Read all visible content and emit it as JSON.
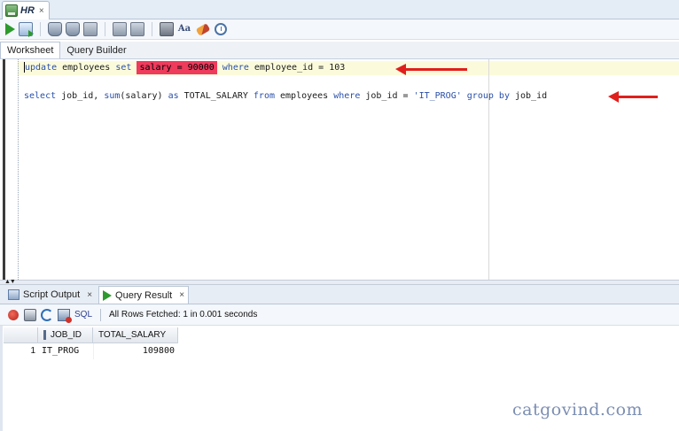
{
  "doc_tab": {
    "label": "HR",
    "close": "×"
  },
  "toolbar": {
    "icons": [
      "run-statement-icon",
      "run-script-icon",
      "commit-icon",
      "rollback-icon",
      "sql-tuning-icon",
      "explain-plan-icon",
      "autotrace-icon",
      "sql-history-icon",
      "format-icon",
      "clear-icon",
      "timer-icon"
    ],
    "format_glyph": "Aa"
  },
  "sub_tabs": [
    "Worksheet",
    "Query Builder"
  ],
  "editor": {
    "line1": {
      "kw_update": "update",
      "t_employees": " employees ",
      "kw_set": "set",
      "highlight": "salary = 90000",
      "kw_where": "where",
      "tail": " employee_id = 103"
    },
    "line2": {
      "kw_select": "select",
      "t1": " job_id, ",
      "kw_sum": "sum",
      "t2": "(salary) ",
      "kw_as": "as",
      "t3": " TOTAL_SALARY ",
      "kw_from": "from",
      "t4": " employees ",
      "kw_where": "where",
      "t5": " job_id = ",
      "str": "'IT_PROG'",
      "sp": " ",
      "kw_group": "group",
      "sp2": " ",
      "kw_by": "by",
      "t6": " job_id"
    },
    "accent_color": "#ef3b5c",
    "arrow_color": "#e0201d"
  },
  "output_tabs": [
    {
      "label": "Script Output",
      "close": "×"
    },
    {
      "label": "Query Result",
      "close": "×"
    }
  ],
  "result_toolbar": {
    "sql_label": "SQL",
    "status": "All Rows Fetched: 1 in 0.001 seconds"
  },
  "grid": {
    "columns": [
      "JOB_ID",
      "TOTAL_SALARY"
    ],
    "rows": [
      {
        "num": "1",
        "job_id": "IT_PROG",
        "total_salary": "109800"
      }
    ]
  },
  "watermark": "catgovind.com"
}
